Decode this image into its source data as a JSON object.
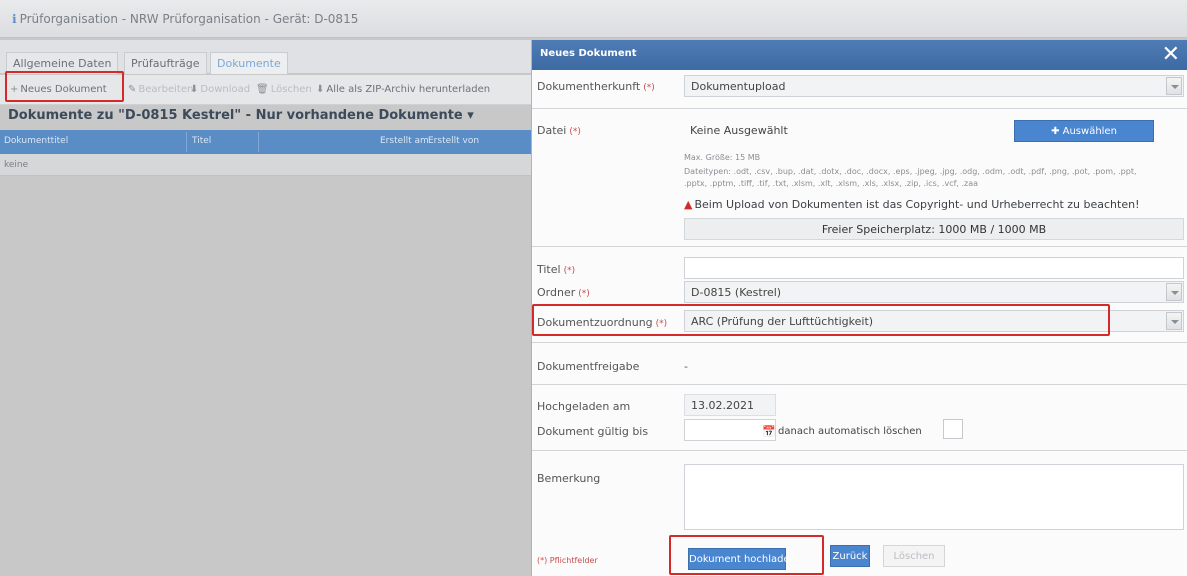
{
  "window_title": "Prüforganisation - NRW Prüforganisation - Gerät: D-0815",
  "tabs": [
    "Allgemeine Daten",
    "Prüfaufträge",
    "Dokumente"
  ],
  "toolbar": {
    "new_document": "Neues Dokument",
    "edit": "Bearbeiten",
    "download": "Download",
    "delete": "Löschen",
    "zip_download": "Alle als ZIP-Archiv herunterladen"
  },
  "documents_heading": "Dokumente zu \"D-0815 Kestrel\" - Nur vorhandene Dokumente",
  "grid": {
    "columns": [
      "Dokumenttitel",
      "Titel",
      "Erstellt am",
      "Erstellt von"
    ],
    "empty_text": "keine"
  },
  "modal": {
    "title": "Neues Dokument",
    "required_mark": "(*)",
    "fields": {
      "origin_label": "Dokumentherkunft",
      "origin_value": "Dokumentupload",
      "file_label": "Datei",
      "file_value": "Keine Ausgewählt",
      "choose_button": "Auswählen",
      "max_size": "Max. Größe: 15 MB",
      "file_types_line1": "Dateitypen: .odt, .csv, .bup, .dat, .dotx, .doc, .docx, .eps, .jpeg, .jpg, .odg, .odm, .odt, .pdf, .png, .pot, .pom, .ppt,",
      "file_types_line2": ".pptx, .pptm, .tiff, .tif, .txt, .xlsm, .xlt, .xlsm, .xls, .xlsx, .zip, .ics, .vcf, .zaa",
      "warning": "Beim Upload von Dokumenten ist das Copyright- und Urheberrecht zu beachten!",
      "storage": "Freier Speicherplatz: 1000 MB / 1000 MB",
      "title_label": "Titel",
      "title_value": "",
      "folder_label": "Ordner",
      "folder_value": "D-0815 (Kestrel)",
      "assignment_label": "Dokumentzuordnung",
      "assignment_value": "ARC (Prüfung der Lufttüchtigkeit)",
      "release_label": "Dokumentfreigabe",
      "release_value": "-",
      "uploaded_label": "Hochgeladen am",
      "uploaded_value": "13.02.2021",
      "valid_label": "Dokument gültig bis",
      "valid_value": "",
      "auto_delete": "danach automatisch löschen",
      "remark_label": "Bemerkung",
      "remark_value": ""
    },
    "footer": {
      "required_note": "(*) Pflichtfelder",
      "upload_button": "Dokument hochladen",
      "back_button": "Zurück",
      "delete_button": "Löschen"
    }
  },
  "colors": {
    "accent_blue": "#4a85cf",
    "header_blue": "#3e6aa3",
    "highlight_red": "#d42a2a"
  }
}
